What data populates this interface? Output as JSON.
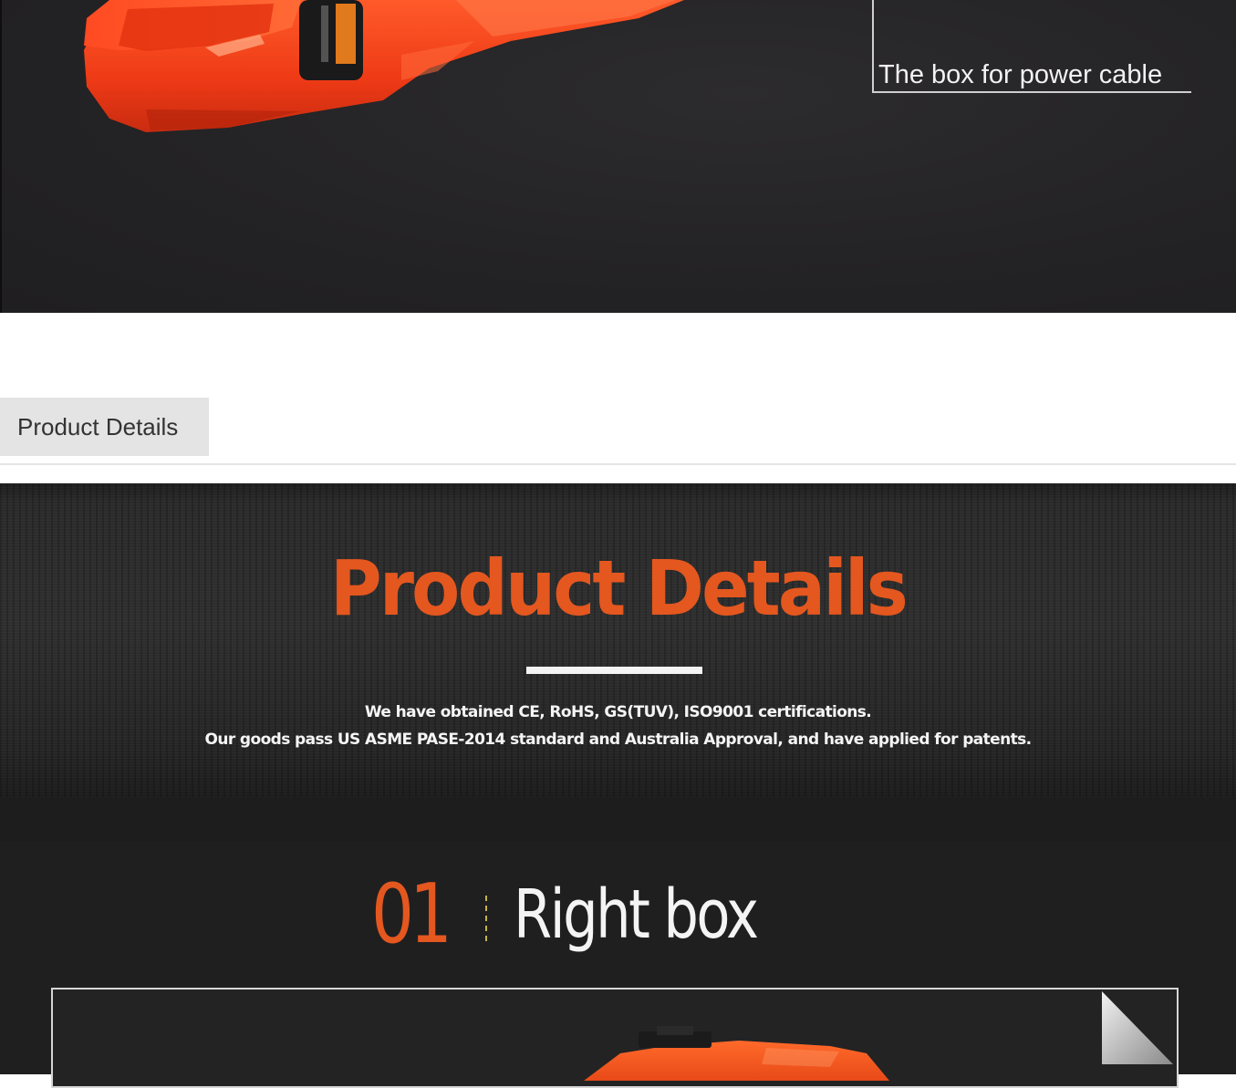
{
  "top_image": {
    "callout_label": "The box for power cable"
  },
  "tabs": [
    {
      "label": "Product Details"
    }
  ],
  "details_banner": {
    "title": "Product Details",
    "lines": [
      "We have obtained CE, RoHS, GS(TUV), ISO9001 certifications.",
      "Our goods pass US ASME PASE-2014 standard and Australia Approval, and have applied for patents."
    ]
  },
  "section": {
    "number": "01",
    "title": "Right box"
  },
  "colors": {
    "accent_orange": "#e4571f",
    "dark_bg": "#232224",
    "tab_bg": "#e4e4e4"
  }
}
